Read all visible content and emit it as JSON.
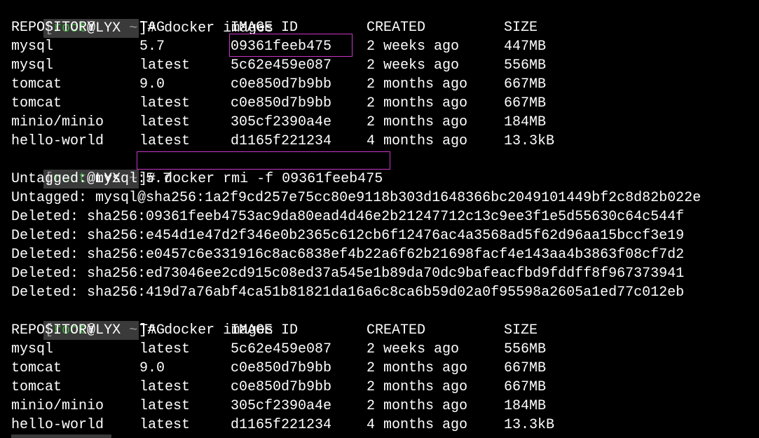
{
  "prompt": {
    "open_bracket": "[",
    "user": "root",
    "at": "@",
    "host": "LYX",
    "cwd": "~",
    "close": "]#"
  },
  "commands": {
    "images1": "docker images",
    "rmi": "docker rmi -f 09361feeb475",
    "images2": "docker images"
  },
  "table_headers": [
    "REPOSITORY",
    "TAG",
    "IMAGE ID",
    "CREATED",
    "SIZE"
  ],
  "images_before": [
    [
      "mysql",
      "5.7",
      "09361feeb475",
      "2 weeks ago",
      "447MB"
    ],
    [
      "mysql",
      "latest",
      "5c62e459e087",
      "2 weeks ago",
      "556MB"
    ],
    [
      "tomcat",
      "9.0",
      "c0e850d7b9bb",
      "2 months ago",
      "667MB"
    ],
    [
      "tomcat",
      "latest",
      "c0e850d7b9bb",
      "2 months ago",
      "667MB"
    ],
    [
      "minio/minio",
      "latest",
      "305cf2390a4e",
      "2 months ago",
      "184MB"
    ],
    [
      "hello-world",
      "latest",
      "d1165f221234",
      "4 months ago",
      "13.3kB"
    ]
  ],
  "rmi_output": [
    "Untagged: mysql:5.7",
    "Untagged: mysql@sha256:1a2f9cd257e75cc80e9118b303d1648366bc2049101449bf2c8d82b022e",
    "Deleted: sha256:09361feeb4753ac9da80ead4d46e2b21247712c13c9ee3f1e5d55630c64c544f",
    "Deleted: sha256:e454d1e47d2f346e0b2365c612cb6f12476ac4a3568ad5f62d96aa15bccf3e19",
    "Deleted: sha256:e0457c6e331916c8ac6838ef4b22a6f62b21698facf4e143aa4b3863f08cf7d2",
    "Deleted: sha256:ed73046ee2cd915c08ed37a545e1b89da70dc9bafeacfbd9fddff8f967373941",
    "Deleted: sha256:419d7a76abf4ca51b81821da16a6c8ca6b59d02a0f95598a2605a1ed77c012eb"
  ],
  "images_after": [
    [
      "mysql",
      "latest",
      "5c62e459e087",
      "2 weeks ago",
      "556MB"
    ],
    [
      "tomcat",
      "9.0",
      "c0e850d7b9bb",
      "2 months ago",
      "667MB"
    ],
    [
      "tomcat",
      "latest",
      "c0e850d7b9bb",
      "2 months ago",
      "667MB"
    ],
    [
      "minio/minio",
      "latest",
      "305cf2390a4e",
      "2 months ago",
      "184MB"
    ],
    [
      "hello-world",
      "latest",
      "d1165f221234",
      "4 months ago",
      "13.3kB"
    ]
  ],
  "colors": {
    "background": "#000000",
    "text": "#ffffff",
    "user": "#3fa33f",
    "dim": "#9a9a9a",
    "prompt_bg": "#3a3a3a",
    "highlight": "#c736c7"
  }
}
